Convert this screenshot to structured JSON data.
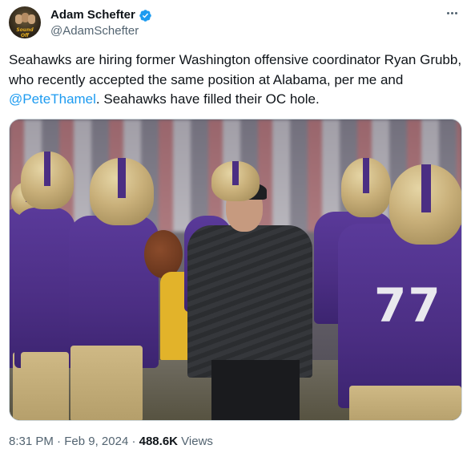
{
  "author": {
    "display_name": "Adam Schefter",
    "handle": "@AdamSchefter",
    "avatar_logo_text": "Sound Off",
    "verified_color": "#1d9bf0"
  },
  "icons": {
    "verified": "verified-badge-icon",
    "more": "more-options-icon"
  },
  "tweet": {
    "text_part1": "Seahawks are hiring former Washington offensive coordinator Ryan Grubb, who recently accepted the same position at Alabama, per me and ",
    "mention": "@PeteThamel",
    "text_part2": ". Seahawks have filled their OC hole.",
    "photo_jersey_number": "77"
  },
  "meta": {
    "time": "8:31 PM",
    "separator1": " · ",
    "date": "Feb 9, 2024",
    "separator2": " · ",
    "views_count": "488.6K",
    "views_label": " Views"
  },
  "colors": {
    "link": "#1d9bf0",
    "secondary_text": "#536471",
    "husky_purple": "#4b2e83",
    "husky_gold": "#c9b07a"
  }
}
